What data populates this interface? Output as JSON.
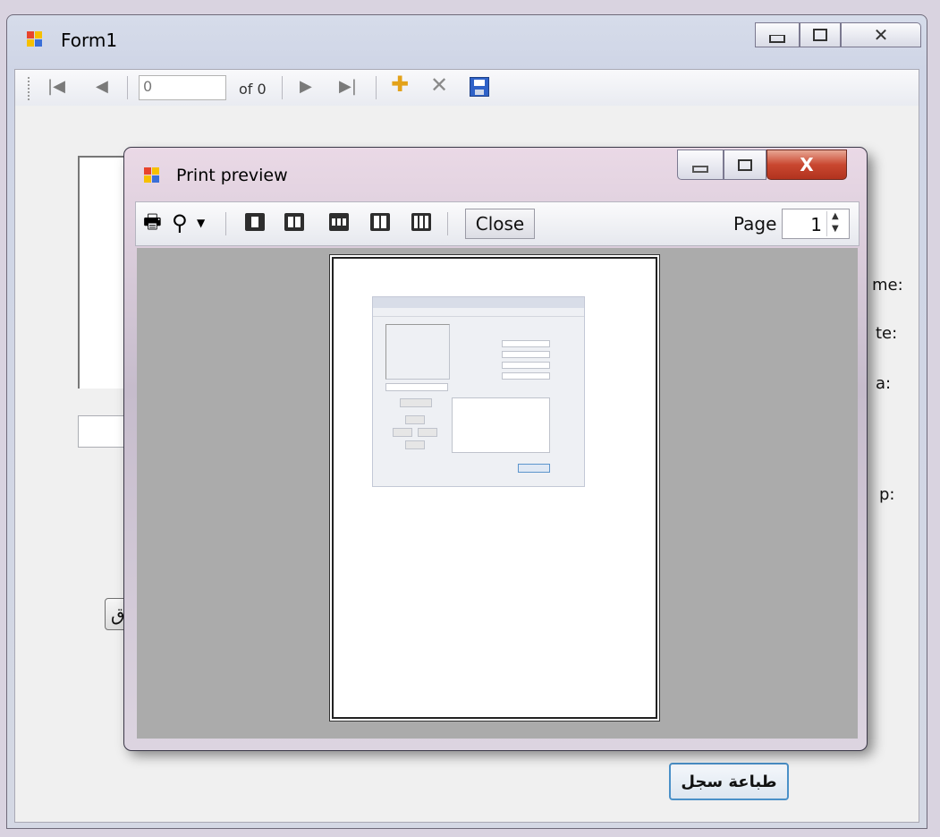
{
  "form1": {
    "title": "Form1",
    "navigator": {
      "position_value": "0",
      "count_label": "of 0"
    },
    "side_labels": [
      "me:",
      "te:",
      "a:",
      "p:"
    ],
    "side_button_label": "ق",
    "print_record_button": "طباعة سجل"
  },
  "print_preview": {
    "title": "Print preview",
    "close_button": "Close",
    "page_label": "Page",
    "page_value": "1"
  },
  "icons": {
    "minimize": "minimize-icon",
    "maximize": "maximize-icon",
    "close": "close-icon",
    "move_first": "move-first-icon",
    "move_previous": "move-previous-icon",
    "move_next": "move-next-icon",
    "move_last": "move-last-icon",
    "add_new": "add-new-icon",
    "delete": "delete-icon",
    "save": "save-icon",
    "print": "print-icon",
    "zoom": "zoom-icon"
  },
  "colors": {
    "accent_button_border": "#4a90c8",
    "close_red": "#c94730",
    "preview_background": "#ababab"
  }
}
